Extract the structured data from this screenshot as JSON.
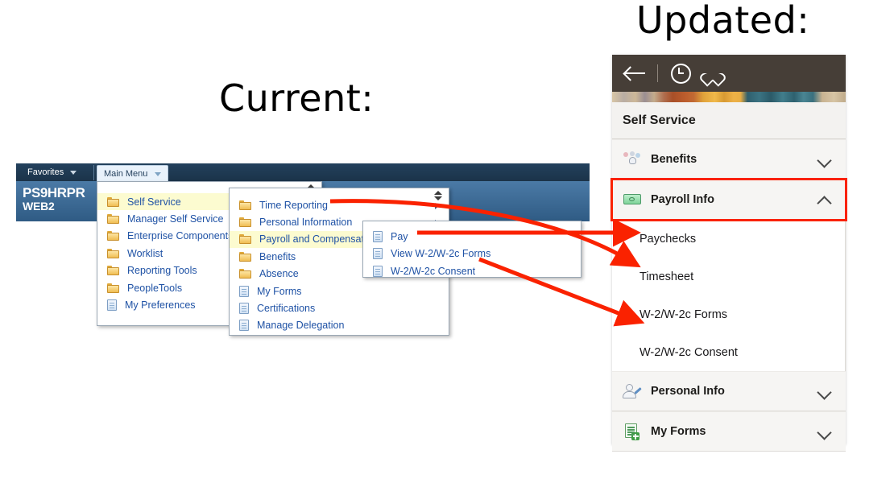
{
  "headings": {
    "current": "Current:",
    "updated": "Updated:"
  },
  "colors": {
    "accent_red": "#fa2200",
    "classic_header_dark": "#1b3349",
    "classic_header_light": "#3b6a97",
    "fluid_header_brown": "#463e37",
    "menu_link_blue": "#1f52a5",
    "selected_row_yellow": "#fcfbd0"
  },
  "classic": {
    "favorites_label": "Favorites",
    "main_menu_label": "Main Menu",
    "logo_line1": "PS9HRPR",
    "logo_line2": "WEB2",
    "scroll_icon": "scroll-up-down-icon",
    "level1": {
      "items": [
        {
          "label": "Self Service",
          "icon": "folder-icon",
          "selected": true,
          "has_submenu": false
        },
        {
          "label": "Manager Self Service",
          "icon": "folder-icon",
          "selected": false,
          "has_submenu": false
        },
        {
          "label": "Enterprise Components",
          "icon": "folder-icon",
          "selected": false,
          "has_submenu": false
        },
        {
          "label": "Worklist",
          "icon": "folder-icon",
          "selected": false,
          "has_submenu": false
        },
        {
          "label": "Reporting Tools",
          "icon": "folder-icon",
          "selected": false,
          "has_submenu": false
        },
        {
          "label": "PeopleTools",
          "icon": "folder-icon",
          "selected": false,
          "has_submenu": false
        },
        {
          "label": "My Preferences",
          "icon": "page-icon",
          "selected": false,
          "has_submenu": false
        }
      ]
    },
    "level2": {
      "items": [
        {
          "label": "Time Reporting",
          "icon": "folder-icon",
          "selected": false,
          "has_submenu": true
        },
        {
          "label": "Personal Information",
          "icon": "folder-icon",
          "selected": false,
          "has_submenu": true
        },
        {
          "label": "Payroll and Compensation",
          "icon": "folder-icon",
          "selected": true,
          "has_submenu": false
        },
        {
          "label": "Benefits",
          "icon": "folder-icon",
          "selected": false,
          "has_submenu": false
        },
        {
          "label": "Absence",
          "icon": "folder-icon",
          "selected": false,
          "has_submenu": false
        },
        {
          "label": "My Forms",
          "icon": "page-icon",
          "selected": false,
          "has_submenu": false
        },
        {
          "label": "Certifications",
          "icon": "page-icon",
          "selected": false,
          "has_submenu": false
        },
        {
          "label": "Manage Delegation",
          "icon": "page-icon",
          "selected": false,
          "has_submenu": false
        }
      ]
    },
    "level3": {
      "items": [
        {
          "label": "Pay",
          "icon": "page-icon",
          "selected": false,
          "has_submenu": false
        },
        {
          "label": "View W-2/W-2c Forms",
          "icon": "page-icon",
          "selected": false,
          "has_submenu": false
        },
        {
          "label": "W-2/W-2c Consent",
          "icon": "page-icon",
          "selected": false,
          "has_submenu": false
        }
      ]
    }
  },
  "fluid": {
    "header_icons": [
      "back-arrow-icon",
      "recent-clock-icon",
      "favorites-heart-icon"
    ],
    "title": "Self Service",
    "rows": [
      {
        "label": "Benefits",
        "icon": "benefits-icon",
        "chevron": "chevron-down-icon",
        "expanded": false,
        "highlighted": false
      },
      {
        "label": "Payroll Info",
        "icon": "payroll-money-icon",
        "chevron": "chevron-up-icon",
        "expanded": true,
        "highlighted": true
      },
      {
        "label": "Personal Info",
        "icon": "person-edit-icon",
        "chevron": "chevron-down-icon",
        "expanded": false,
        "highlighted": false
      },
      {
        "label": "My Forms",
        "icon": "forms-add-icon",
        "chevron": "chevron-down-icon",
        "expanded": false,
        "highlighted": false
      }
    ],
    "payroll_children": [
      "Paychecks",
      "Timesheet",
      "W-2/W-2c Forms",
      "W-2/W-2c Consent"
    ]
  },
  "annotations": {
    "arrows": [
      {
        "name": "arrow-pay-to-paychecks",
        "from": "Pay",
        "to": "Paychecks",
        "shape": "straight"
      },
      {
        "name": "arrow-timereporting-to-timesheet",
        "from": "Time Reporting",
        "to": "Timesheet",
        "shape": "curved"
      },
      {
        "name": "arrow-w2forms-to-w2forms",
        "from": "View W-2/W-2c Forms",
        "to": "W-2/W-2c Forms",
        "shape": "straight"
      }
    ],
    "highlight_box": {
      "name": "payroll-info-highlight",
      "target": "Payroll Info",
      "color": "#fa2200"
    }
  }
}
